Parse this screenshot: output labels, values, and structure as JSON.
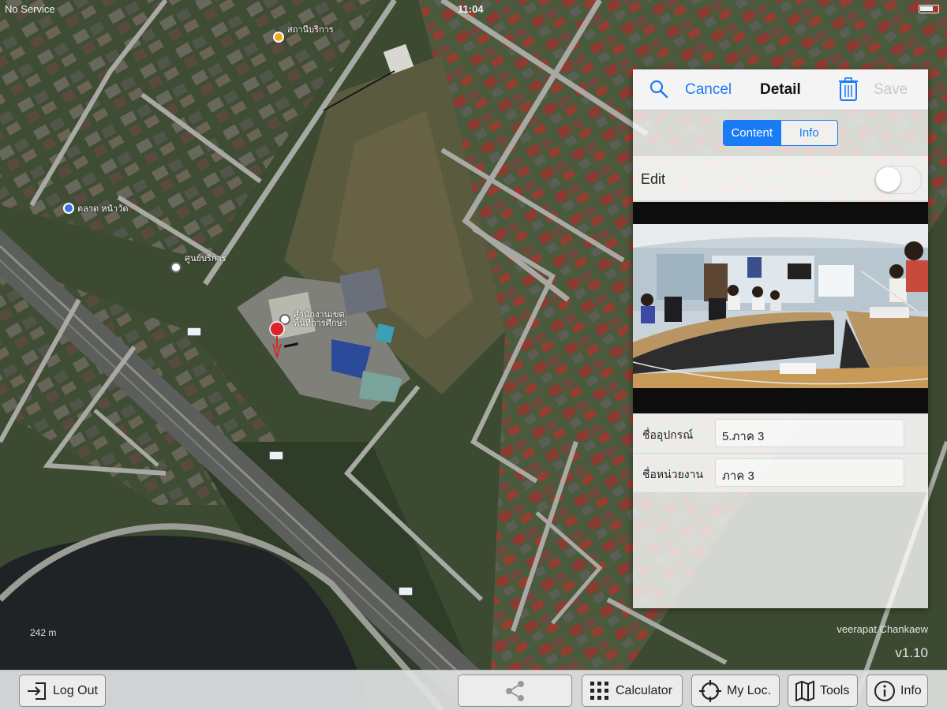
{
  "status_bar": {
    "carrier": "No Service",
    "time": "11:04"
  },
  "map": {
    "pois": [
      {
        "label": "สถานีบริการ",
        "icon": "fuel-icon"
      },
      {
        "label": "ตลาด หน้าวัด",
        "icon": "place-icon"
      },
      {
        "label": "ศูนย์บริการ",
        "icon": "building-icon"
      },
      {
        "label": "สำนักงานเขต พื้นที่การศึกษา",
        "icon": "school-icon"
      }
    ],
    "scale_label": "242 m",
    "author": "veerapat Chankaew",
    "version": "v1.10"
  },
  "detail": {
    "cancel_label": "Cancel",
    "title": "Detail",
    "save_label": "Save",
    "segments": [
      "Content",
      "Info"
    ],
    "selected_segment": "Content",
    "edit_label": "Edit",
    "edit_on": false,
    "fields": [
      {
        "label": "ชื่ออุปกรณ์",
        "value": "5.ภาค 3"
      },
      {
        "label": "ชื่อหน่วยงาน",
        "value": "ภาค 3"
      }
    ]
  },
  "toolbar": {
    "logout_label": "Log Out",
    "calculator_label": "Calculator",
    "myloc_label": "My Loc.",
    "tools_label": "Tools",
    "info_label": "Info"
  },
  "colors": {
    "accent": "#1a7cf5",
    "pin": "#d9252a",
    "disabled": "#c6c9cc"
  }
}
